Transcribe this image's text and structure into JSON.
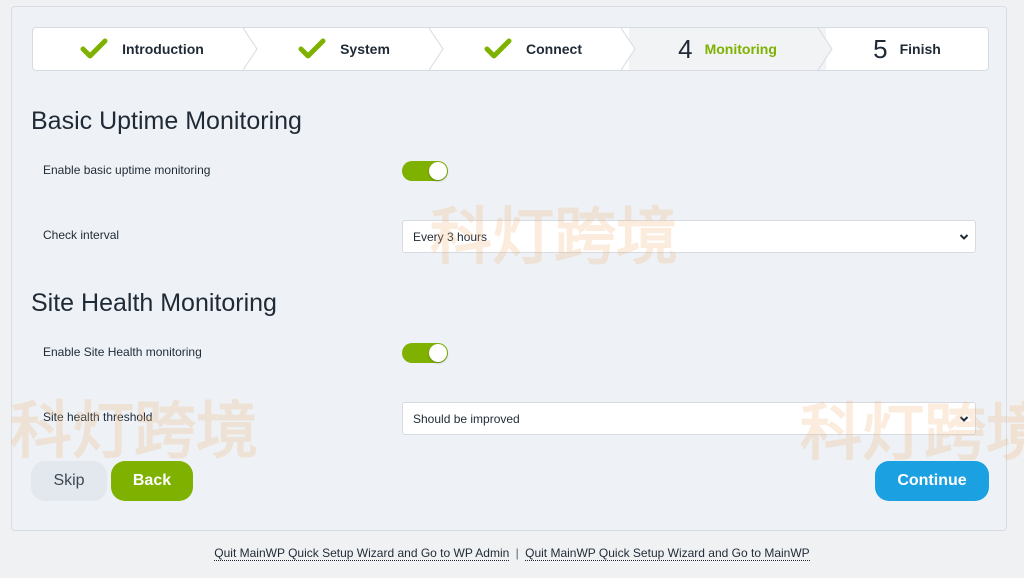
{
  "steps": [
    {
      "label": "Introduction",
      "state": "done"
    },
    {
      "label": "System",
      "state": "done"
    },
    {
      "label": "Connect",
      "state": "done"
    },
    {
      "number": "4",
      "label": "Monitoring",
      "state": "active"
    },
    {
      "number": "5",
      "label": "Finish",
      "state": "pending"
    }
  ],
  "uptime": {
    "title": "Basic Uptime Monitoring",
    "enable_label": "Enable basic uptime monitoring",
    "enable_value": true,
    "interval_label": "Check interval",
    "interval_value": "Every 3 hours"
  },
  "health": {
    "title": "Site Health Monitoring",
    "enable_label": "Enable Site Health monitoring",
    "enable_value": true,
    "threshold_label": "Site health threshold",
    "threshold_value": "Should be improved"
  },
  "buttons": {
    "skip": "Skip",
    "back": "Back",
    "continue": "Continue"
  },
  "footer": {
    "link_admin": "Quit MainWP Quick Setup Wizard and Go to WP Admin",
    "separator": "|",
    "link_mainwp": "Quit MainWP Quick Setup Wizard and Go to MainWP"
  },
  "watermark": "科灯跨境",
  "colors": {
    "accent_green": "#7fb100",
    "accent_blue": "#1ba0e2"
  }
}
